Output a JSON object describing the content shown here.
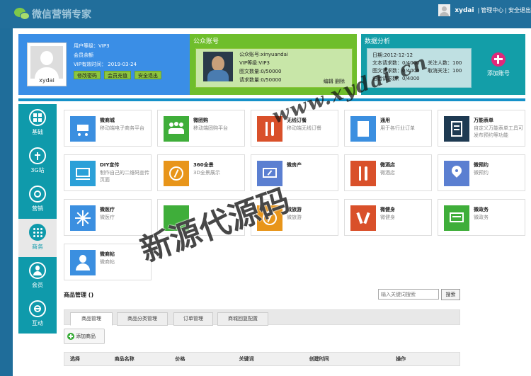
{
  "header": {
    "logo_text": "微信营销专家",
    "username": "xydai",
    "sep": "|",
    "admin_center": "管理中心",
    "logout": "安全退出"
  },
  "user_panel": {
    "name": "xydai",
    "level": "用户等级：VIP3",
    "member": "会员余额",
    "vip_expire": "VIP有效时间：  2019-03-24",
    "btn_pwd": "修改密码",
    "btn_recharge": "会员充值",
    "btn_logout": "安全退出"
  },
  "account_panel": {
    "title": "公众账号",
    "acct": "公众账号:xinyuandai",
    "vip": "VIP等级:VIP3",
    "img_text": "图文数量:0/50000",
    "requests": "请求数量:0/50000",
    "edit": "编辑",
    "delete": "删除"
  },
  "data_panel": {
    "title": "数据分析",
    "date": "日期:2012-12-12",
    "r1a": "文本请求数：0/4000",
    "r1b": "关注人数：100",
    "r2a": "图文请求数：0/4000",
    "r2b": "取消关注：100",
    "r3a": "语音请求数：0/4000",
    "add_account": "添加账号"
  },
  "sidenav": [
    {
      "label": "基础"
    },
    {
      "label": "3G站"
    },
    {
      "label": "营销"
    },
    {
      "label": "商务"
    },
    {
      "label": "会员"
    },
    {
      "label": "互动"
    }
  ],
  "tiles": [
    {
      "title": "微商城",
      "desc": "移动端电子商务平台",
      "color": "#3b8fe0"
    },
    {
      "title": "微团购",
      "desc": "移动端团购平台",
      "color": "#3fae3a"
    },
    {
      "title": "无线订餐",
      "desc": "移动端无线订餐",
      "color": "#d9502a"
    },
    {
      "title": "通用",
      "desc": "用于各行业订单",
      "color": "#3b8fe0"
    },
    {
      "title": "万能表单",
      "desc": "自定义万能表单工具可发布预约等功能",
      "color": "#1e3a52"
    },
    {
      "title": "DIY宣传",
      "desc": "制作自己的二维码宣传页面",
      "color": "#2ba0d8"
    },
    {
      "title": "360全景",
      "desc": "3D全景展示",
      "color": "#e8951a"
    },
    {
      "title": "微房产",
      "desc": "",
      "color": "#5b7fd1"
    },
    {
      "title": "微酒店",
      "desc": "微酒店",
      "color": "#d9502a"
    },
    {
      "title": "微预约",
      "desc": "微预约",
      "color": "#5b7fd1"
    },
    {
      "title": "微医疗",
      "desc": "微医疗",
      "color": "#3b8fe0"
    },
    {
      "title": "",
      "desc": "",
      "color": "#3fae3a"
    },
    {
      "title": "微旅游",
      "desc": "微旅游",
      "color": "#e8951a"
    },
    {
      "title": "微健身",
      "desc": "微健身",
      "color": "#d9502a"
    },
    {
      "title": "微政务",
      "desc": "微政务",
      "color": "#3fae3a"
    },
    {
      "title": "微商帖",
      "desc": "微商帖",
      "color": "#3b8fe0"
    }
  ],
  "product": {
    "title": "商品管理 ()",
    "search_placeholder": "输入关键词搜索",
    "search_btn": "搜索",
    "tabs": [
      "商品管理",
      "商品分类管理",
      "订单管理",
      "商城回复配置"
    ],
    "add_btn": "添加商品",
    "columns": [
      "选择",
      "商品名称",
      "价格",
      "关键词",
      "创建时间",
      "操作"
    ]
  },
  "watermark": {
    "url": "www.xydai.cn",
    "brand": "新源代源码"
  }
}
